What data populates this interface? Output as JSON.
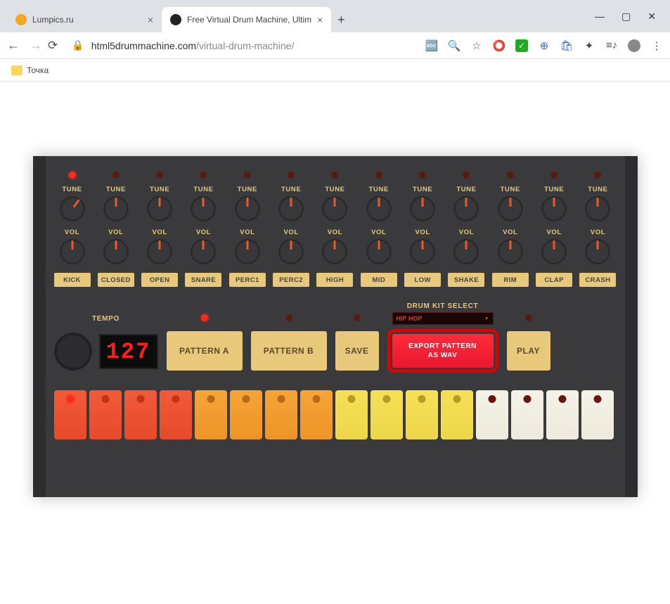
{
  "browser": {
    "tabs": [
      {
        "title": "Lumpics.ru",
        "active": false
      },
      {
        "title": "Free Virtual Drum Machine, Ultim",
        "active": true
      }
    ],
    "url_host": "html5drummachine.com",
    "url_path": "/virtual-drum-machine/",
    "bookmark": "Точка"
  },
  "machine": {
    "tracks": [
      {
        "name": "KICK",
        "led_on": true
      },
      {
        "name": "CLOSED",
        "led_on": false
      },
      {
        "name": "OPEN",
        "led_on": false
      },
      {
        "name": "SNARE",
        "led_on": false
      },
      {
        "name": "PERC1",
        "led_on": false
      },
      {
        "name": "PERC2",
        "led_on": false
      },
      {
        "name": "HIGH",
        "led_on": false
      },
      {
        "name": "MID",
        "led_on": false
      },
      {
        "name": "LOW",
        "led_on": false
      },
      {
        "name": "SHAKE",
        "led_on": false
      },
      {
        "name": "RIM",
        "led_on": false
      },
      {
        "name": "CLAP",
        "led_on": false
      },
      {
        "name": "CRASH",
        "led_on": false
      }
    ],
    "tune_label": "TUNE",
    "vol_label": "VOL",
    "tempo_label": "TEMPO",
    "tempo_value": "127",
    "pattern_a": "PATTERN A",
    "pattern_b": "PATTERN B",
    "save": "SAVE",
    "kit_label": "DRUM KIT SELECT",
    "kit_value": "HIP HOP",
    "export_label": "EXPORT PATTERN AS WAV",
    "play": "PLAY",
    "pattern_a_led_on": true,
    "pattern_b_led_on": false,
    "save_led_on": false,
    "play_led_on": false,
    "steps": [
      {
        "c": "r",
        "a": true
      },
      {
        "c": "r"
      },
      {
        "c": "r"
      },
      {
        "c": "r"
      },
      {
        "c": "o"
      },
      {
        "c": "o"
      },
      {
        "c": "o"
      },
      {
        "c": "o"
      },
      {
        "c": "y"
      },
      {
        "c": "y"
      },
      {
        "c": "y"
      },
      {
        "c": "y"
      },
      {
        "c": "w"
      },
      {
        "c": "w"
      },
      {
        "c": "w"
      },
      {
        "c": "w"
      }
    ]
  }
}
